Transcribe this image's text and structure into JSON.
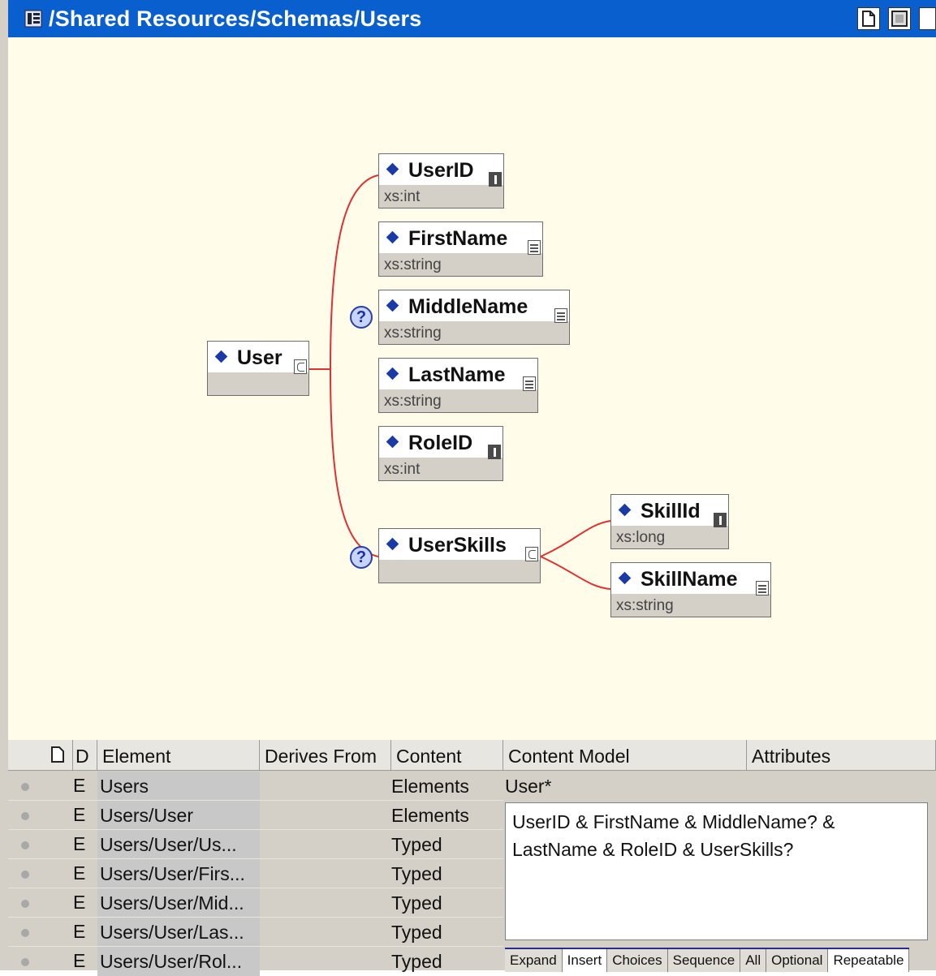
{
  "window": {
    "title": "/Shared Resources/Schemas/Users",
    "accent": "#0a5fcf"
  },
  "diagram": {
    "line_color": "#e03030",
    "nodes": [
      {
        "id": "user",
        "name": "User",
        "type": "",
        "badge": "complex-icon"
      },
      {
        "id": "userid",
        "name": "UserID",
        "type": "xs:int",
        "badge": "info-icon"
      },
      {
        "id": "firstname",
        "name": "FirstName",
        "type": "xs:string",
        "badge": "lines-icon"
      },
      {
        "id": "middlename",
        "name": "MiddleName",
        "type": "xs:string",
        "badge": "lines-icon",
        "optional": true
      },
      {
        "id": "lastname",
        "name": "LastName",
        "type": "xs:string",
        "badge": "lines-icon"
      },
      {
        "id": "roleid",
        "name": "RoleID",
        "type": "xs:int",
        "badge": "info-icon"
      },
      {
        "id": "userskills",
        "name": "UserSkills",
        "type": "",
        "badge": "complex-icon",
        "optional": true
      },
      {
        "id": "skillid",
        "name": "SkillId",
        "type": "xs:long",
        "badge": "info-icon"
      },
      {
        "id": "skillname",
        "name": "SkillName",
        "type": "xs:string",
        "badge": "lines-icon"
      }
    ],
    "optional_marker": "?"
  },
  "grid": {
    "headers": {
      "d": "D",
      "element": "Element",
      "derives": "Derives From",
      "content": "Content",
      "content_model": "Content Model",
      "attributes": "Attributes"
    },
    "rows": [
      {
        "kind": "E",
        "element": "Users",
        "content": "Elements"
      },
      {
        "kind": "E",
        "element": "Users/User",
        "content": "Elements"
      },
      {
        "kind": "E",
        "element": "Users/User/Us...",
        "content": "Typed"
      },
      {
        "kind": "E",
        "element": "Users/User/Firs...",
        "content": "Typed"
      },
      {
        "kind": "E",
        "element": "Users/User/Mid...",
        "content": "Typed"
      },
      {
        "kind": "E",
        "element": "Users/User/Las...",
        "content": "Typed"
      },
      {
        "kind": "E",
        "element": "Users/User/Rol...",
        "content": "Typed"
      }
    ],
    "content_model_first": "User*",
    "content_model_text_1": "UserID & FirstName & MiddleName? &",
    "content_model_text_2": "LastName & RoleID & UserSkills?",
    "tabs": [
      "Expand",
      "Insert",
      "Choices",
      "Sequence",
      "All",
      "Optional",
      "Repeatable"
    ]
  }
}
